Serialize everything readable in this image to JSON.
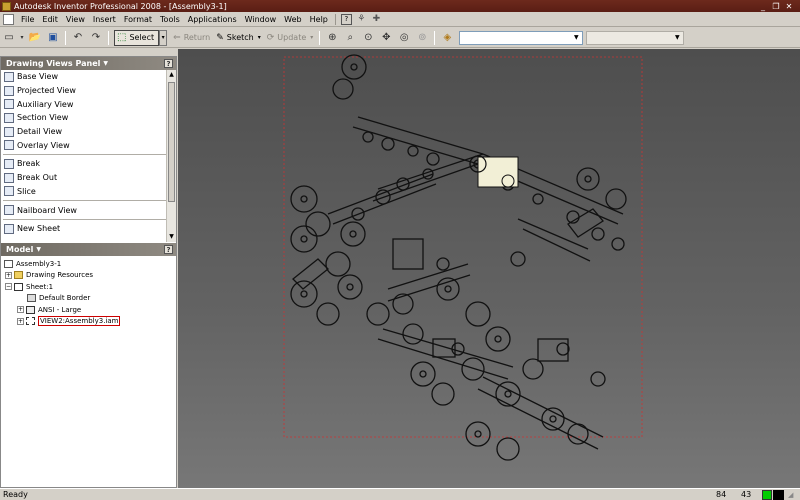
{
  "window": {
    "title": "Autodesk Inventor Professional 2008 - [Assembly3-1]",
    "controls": [
      "minimize",
      "restore",
      "close"
    ]
  },
  "menubar": {
    "items": [
      "File",
      "Edit",
      "View",
      "Insert",
      "Format",
      "Tools",
      "Applications",
      "Window",
      "Web",
      "Help"
    ]
  },
  "toolbar": {
    "select_label": "Select",
    "return_label": "Return",
    "sketch_label": "Sketch",
    "update_label": "Update",
    "combo1_value": "",
    "combo2_value": ""
  },
  "views_panel": {
    "title": "Drawing Views Panel",
    "items": [
      "Base View",
      "Projected View",
      "Auxiliary View",
      "Section View",
      "Detail View",
      "Overlay View",
      "Break",
      "Break Out",
      "Slice",
      "Nailboard View",
      "New Sheet"
    ]
  },
  "model_panel": {
    "title": "Model",
    "tree": {
      "root": "Assembly3-1",
      "drawing_resources": "Drawing Resources",
      "sheet": "Sheet:1",
      "default_border": "Default Border",
      "ansi": "ANSI - Large",
      "view": "VIEW2:Assembly3.iam"
    }
  },
  "statusbar": {
    "status": "Ready",
    "value1": "84",
    "value2": "43",
    "indicator_color": "#00cc00"
  }
}
